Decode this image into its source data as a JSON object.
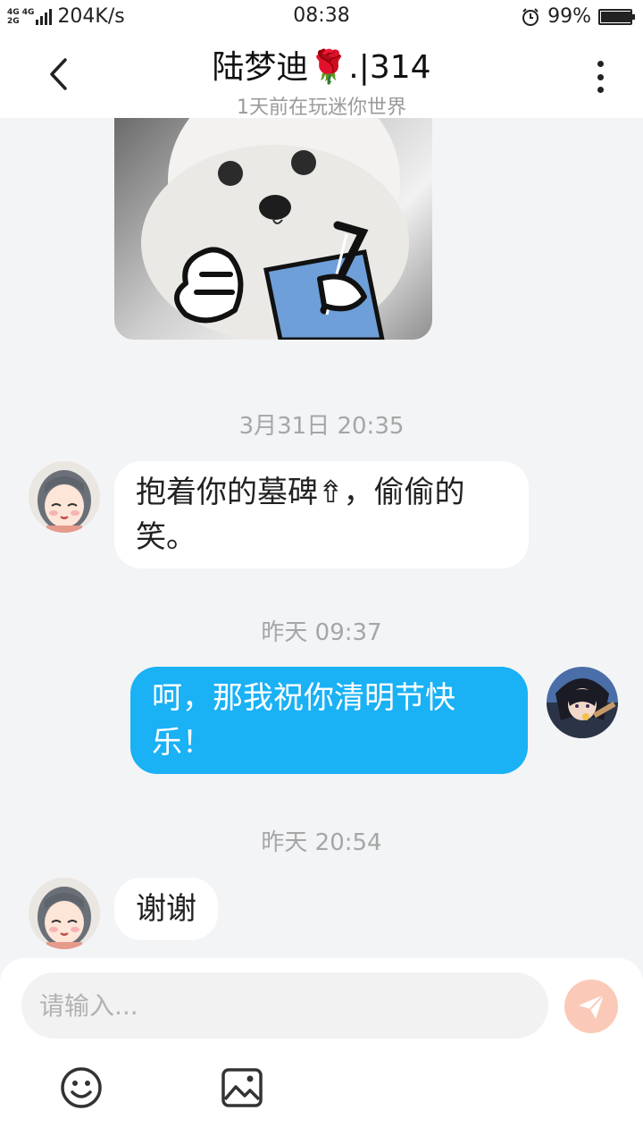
{
  "status_bar": {
    "network_type_top": "4G 4G",
    "network_type_bottom": "2G",
    "speed": "204K/s",
    "time": "08:38",
    "battery_percent": "99%",
    "battery_level": 0.99,
    "icons": [
      "signal-icon",
      "alarm-icon",
      "battery-icon"
    ]
  },
  "header": {
    "title_name": "陆梦迪",
    "title_rose": "🌹",
    "title_suffix": ".|314",
    "subtitle": "1天前在玩迷你世界",
    "icons": [
      "back-arrow-icon",
      "more-dots-icon"
    ]
  },
  "messages": [
    {
      "type": "sticker",
      "sender": "contact",
      "description_icon": "dog-sticker"
    },
    {
      "type": "timestamp",
      "text": "3月31日 20:35"
    },
    {
      "type": "text",
      "sender": "contact",
      "line1": "抱着你的墓碑⇮，偷偷的",
      "line2": "笑。"
    },
    {
      "type": "timestamp",
      "text": "昨天 09:37"
    },
    {
      "type": "text",
      "sender": "me",
      "line1": "呵，那我祝你清明节快",
      "line2": "乐！"
    },
    {
      "type": "timestamp",
      "text": "昨天 20:54"
    },
    {
      "type": "text",
      "sender": "contact",
      "line1": "谢谢"
    }
  ],
  "input": {
    "placeholder": "请输入..."
  },
  "toolbar": {
    "icons": [
      "send-icon",
      "emoji-icon",
      "image-icon"
    ]
  },
  "colors": {
    "outgoing_bubble": "#1ab1f5",
    "send_button": "#fbc9b8",
    "background": "#f3f4f6"
  }
}
